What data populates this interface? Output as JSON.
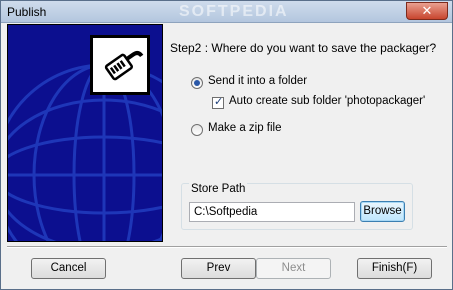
{
  "window": {
    "title": "Publish",
    "watermark": "SOFTPEDIA",
    "close_glyph": "✕"
  },
  "logo": {
    "icon": "network-cable-icon"
  },
  "step": {
    "heading": "Step2 : Where do you want to save the packager?"
  },
  "options": {
    "send_folder_label": "Send it into a folder",
    "send_folder_selected": true,
    "auto_subfolder_label": "Auto create sub folder 'photopackager'",
    "auto_subfolder_checked": true,
    "zip_label": "Make a zip file",
    "zip_selected": false
  },
  "store_path": {
    "title": "Store Path",
    "value": "C:\\Softpedia",
    "browse_label": "Browse"
  },
  "footer": {
    "cancel_label": "Cancel",
    "prev_label": "Prev",
    "next_label": "Next",
    "finish_label": "Finish(F)"
  },
  "colors": {
    "side_panel": "#0c0f8f",
    "globe_lines": "#1e36b8",
    "selection_dot": "#2a58a8"
  }
}
